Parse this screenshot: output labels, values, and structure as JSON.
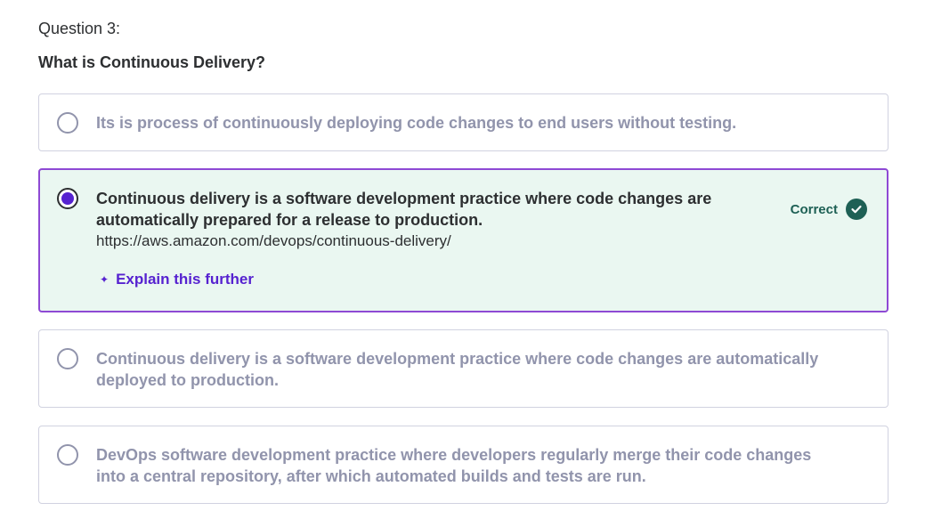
{
  "question": {
    "number_label": "Question 3:",
    "text": "What is Continuous Delivery?"
  },
  "options": [
    {
      "text": "Its is process of continuously deploying code changes to end users without testing.",
      "selected": false
    },
    {
      "text": "Continuous delivery is a software development practice where code changes are automatically prepared for a release to production.",
      "link": "https://aws.amazon.com/devops/continuous-delivery/",
      "selected": true,
      "result_label": "Correct",
      "explain_label": "Explain this further"
    },
    {
      "text": "Continuous delivery is a software development practice where code changes are automatically deployed to production.",
      "selected": false
    },
    {
      "text": "DevOps software development practice where developers regularly merge their code changes into a central repository, after which automated builds and tests are run.",
      "selected": false
    }
  ],
  "colors": {
    "accent_purple": "#5622d0",
    "selected_border": "#8e49d4",
    "correct_green": "#1e6055",
    "selected_background": "#eaf7f1",
    "muted_text": "#9194ac"
  },
  "icons": {
    "correct": "check-circle-icon",
    "explain": "sparkle-icon"
  }
}
